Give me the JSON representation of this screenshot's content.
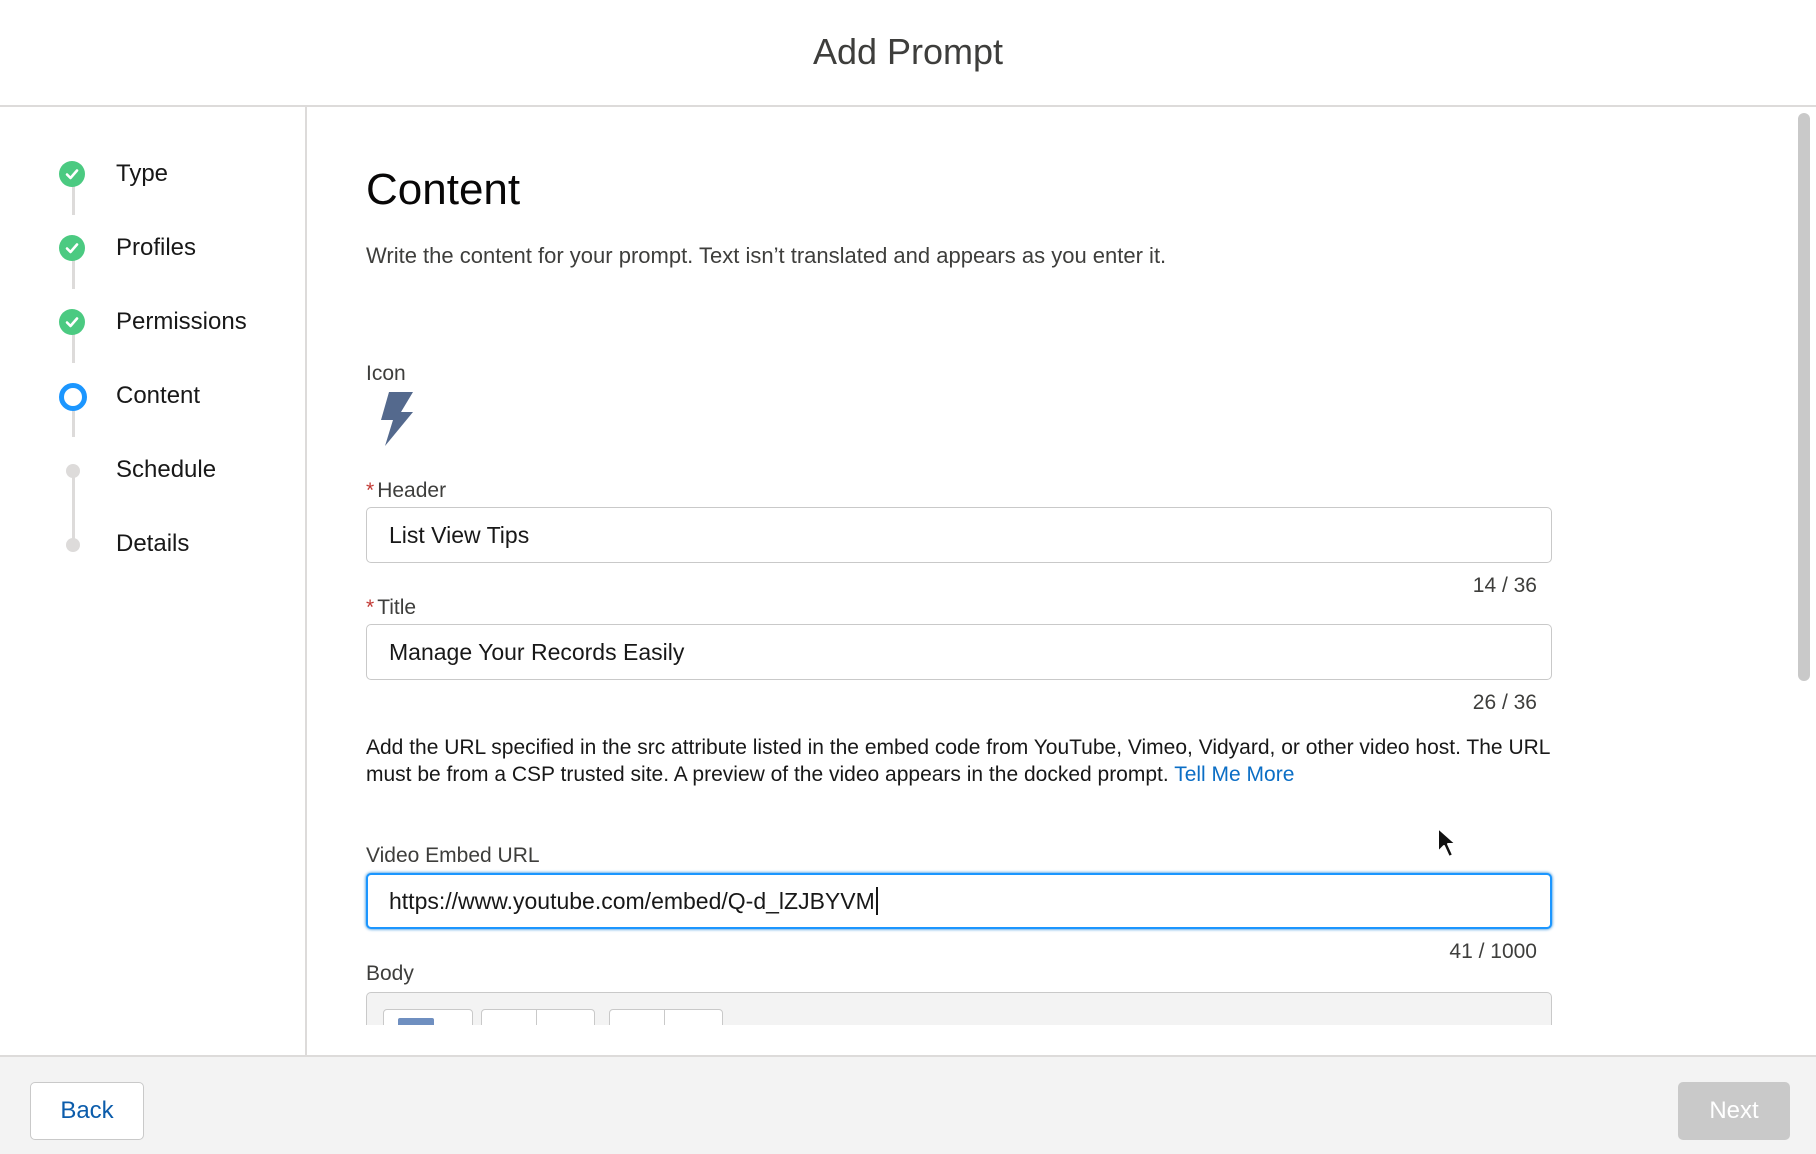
{
  "modal": {
    "title": "Add Prompt"
  },
  "steps": [
    {
      "label": "Type",
      "state": "done"
    },
    {
      "label": "Profiles",
      "state": "done"
    },
    {
      "label": "Permissions",
      "state": "done"
    },
    {
      "label": "Content",
      "state": "current"
    },
    {
      "label": "Schedule",
      "state": "pending"
    },
    {
      "label": "Details",
      "state": "pending"
    }
  ],
  "content": {
    "title": "Content",
    "description": "Write the content for your prompt. Text isn’t translated and appears as you enter it.",
    "icon_label": "Icon",
    "icon": "lightning-bolt-icon",
    "header": {
      "required": "*",
      "label": "Header",
      "value": "List View Tips",
      "counter": "14 / 36"
    },
    "title_field": {
      "required": "*",
      "label": "Title",
      "value": "Manage Your Records Easily",
      "counter": "26 / 36"
    },
    "help_text": "Add the URL specified in the src attribute listed in the embed code from YouTube, Vimeo, Vidyard, or other video host. The URL must be from a CSP trusted site. A preview of the video appears in the docked prompt.",
    "help_link": "Tell Me More",
    "video": {
      "label": "Video Embed URL",
      "value": "https://www.youtube.com/embed/Q-d_lZJBYVM",
      "counter": "41 / 1000"
    },
    "body_label": "Body"
  },
  "footer": {
    "back_label": "Back",
    "next_label": "Next"
  },
  "colors": {
    "done": "#4bca81",
    "current": "#1b96ff",
    "link": "#0b6ec5",
    "next_disabled": "#c9c9c9"
  }
}
